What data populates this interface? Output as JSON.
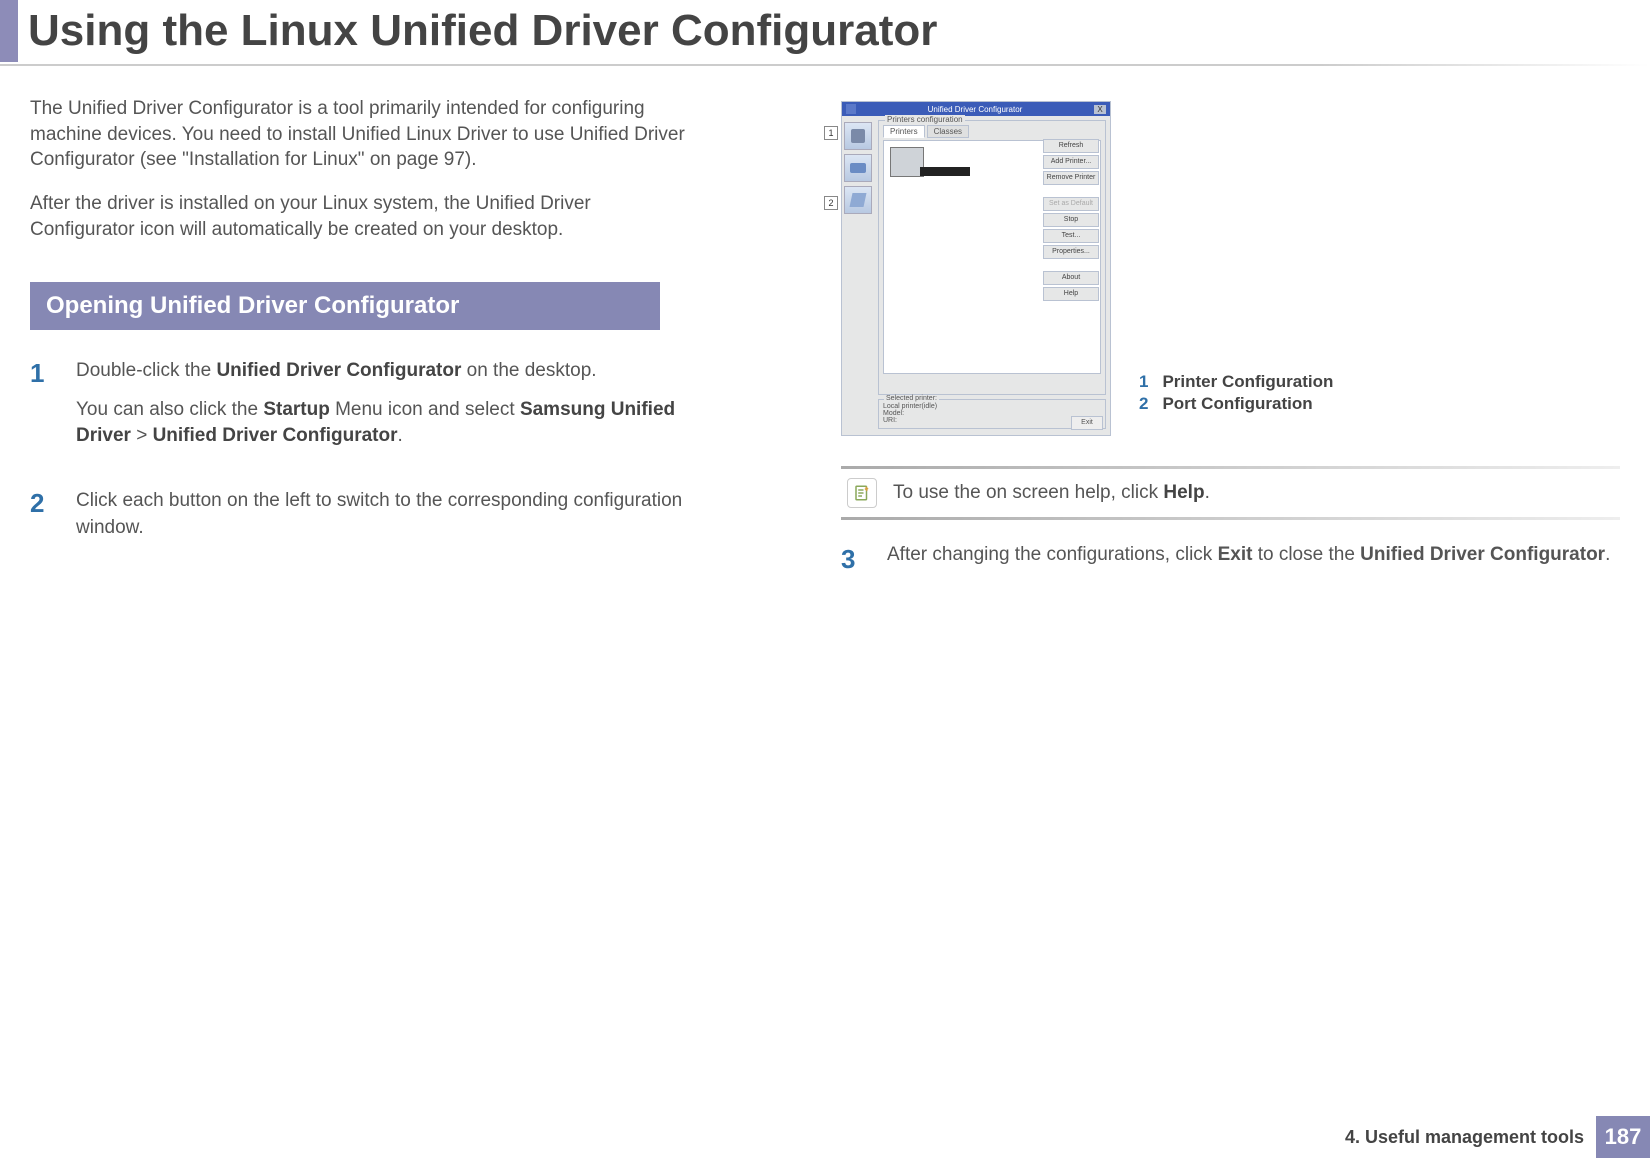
{
  "header": {
    "title": "Using the Linux Unified Driver Configurator"
  },
  "intro": {
    "p1": "The Unified Driver Configurator is a tool primarily intended for configuring machine devices. You need to install Unified Linux Driver to use Unified Driver Configurator (see \"Installation for Linux\" on page 97).",
    "p2": "After the driver is installed on your Linux system, the Unified Driver Configurator icon will automatically be created on your desktop."
  },
  "section_heading": "Opening Unified Driver Configurator",
  "steps": {
    "1": {
      "num": "1",
      "a_pre": "Double-click the ",
      "a_b1": "Unified Driver Configurator",
      "a_post": " on the desktop.",
      "b_pre": "You can also click the ",
      "b_b1": "Startup",
      "b_mid1": " Menu icon and select ",
      "b_b2": "Samsung Unified Driver",
      "b_mid2": " > ",
      "b_b3": "Unified Driver Configurator",
      "b_post": "."
    },
    "2": {
      "num": "2",
      "text": "Click each button on the left to switch to the corresponding configuration window."
    },
    "3": {
      "num": "3",
      "pre": "After changing the configurations, click ",
      "b1": "Exit",
      "mid": " to close the ",
      "b2": "Unified Driver Configurator",
      "post": "."
    }
  },
  "screenshot": {
    "title": "Unified Driver Configurator",
    "group_label": "Printers configuration",
    "close_x": "X",
    "callout1": "1",
    "callout2": "2",
    "tabs": {
      "printers": "Printers",
      "classes": "Classes"
    },
    "buttons": {
      "refresh": "Refresh",
      "add": "Add Printer...",
      "remove": "Remove Printer",
      "setdefault": "Set as Default",
      "stop": "Stop",
      "test": "Test...",
      "properties": "Properties...",
      "about": "About",
      "help": "Help"
    },
    "selected": {
      "label": "Selected printer:",
      "line1": "Local printer(idle)",
      "line2": "Model:",
      "line3": "URI:"
    },
    "exit": "Exit"
  },
  "legend": {
    "n1": "1",
    "l1": "Printer Configuration",
    "n2": "2",
    "l2": "Port Configuration"
  },
  "note": {
    "pre": "To use the on screen help, click ",
    "b1": "Help",
    "post": "."
  },
  "footer": {
    "chapter": "4.  Useful management tools",
    "page": "187"
  }
}
